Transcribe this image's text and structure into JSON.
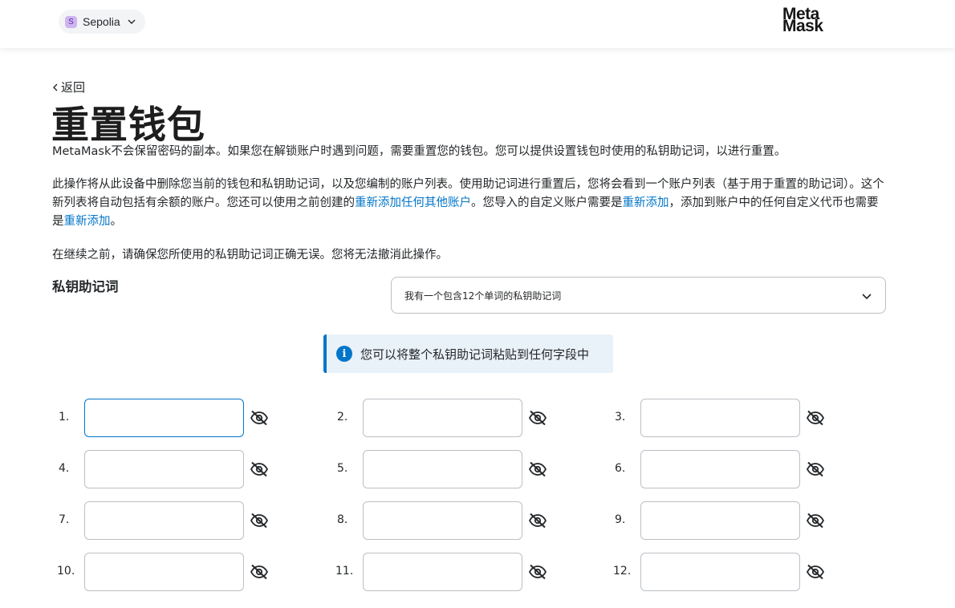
{
  "header": {
    "network_avatar": "S",
    "network_name": "Sepolia",
    "logo_line1": "Meta",
    "logo_line2": "Mask"
  },
  "page": {
    "back_label": "返回",
    "title": "重置钱包",
    "para1": "MetaMask不会保留密码的副本。如果您在解锁账户时遇到问题，需要重置您的钱包。您可以提供设置钱包时使用的私钥助记词，以进行重置。",
    "para2_a": "此操作将从此设备中删除您当前的钱包和私钥助记词，以及您编制的账户列表。使用助记词进行重置后，您将会看到一个账户列表（基于用于重置的助记词）。这个新列表将自动包括有余额的账户。您还可以使用之前创建的",
    "para2_link1": "重新添加任何其他账户",
    "para2_b": "。您导入的自定义账户需要是",
    "para2_link2": "重新添加",
    "para2_c": "，添加到账户中的任何自定义代币也需要是",
    "para2_link3": "重新添加",
    "para2_d": "。",
    "para3": "在继续之前，请确保您所使用的私钥助记词正确无误。您将无法撤消此操作。",
    "srp_label": "私钥助记词",
    "srp_select_value": "我有一个包含12个单词的私钥助记词",
    "info_text": "您可以将整个私钥助记词粘贴到任何字段中"
  },
  "words": [
    {
      "number": "1.",
      "value": ""
    },
    {
      "number": "2.",
      "value": ""
    },
    {
      "number": "3.",
      "value": ""
    },
    {
      "number": "4.",
      "value": ""
    },
    {
      "number": "5.",
      "value": ""
    },
    {
      "number": "6.",
      "value": ""
    },
    {
      "number": "7.",
      "value": ""
    },
    {
      "number": "8.",
      "value": ""
    },
    {
      "number": "9.",
      "value": ""
    },
    {
      "number": "10.",
      "value": ""
    },
    {
      "number": "11.",
      "value": ""
    },
    {
      "number": "12.",
      "value": ""
    }
  ],
  "icons": {
    "visibility": "eye-slash-icon",
    "info": "info-icon",
    "dropdown": "chevron-down-icon",
    "back": "chevron-left-icon"
  },
  "colors": {
    "accent": "#0376c9",
    "info_bg": "#e9f1f9",
    "border": "#bbc0c5"
  }
}
